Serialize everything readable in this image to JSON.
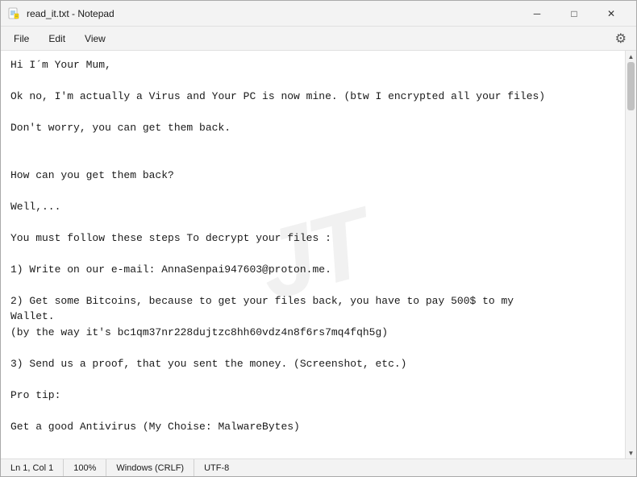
{
  "window": {
    "title": "read_it.txt - Notepad",
    "icon": "notepad-icon"
  },
  "title_controls": {
    "minimize": "─",
    "maximize": "□",
    "close": "✕"
  },
  "menu": {
    "items": [
      "File",
      "Edit",
      "View"
    ],
    "settings_icon": "⚙"
  },
  "content": {
    "text": "Hi I´m Your Mum,\n\nOk no, I'm actually a Virus and Your PC is now mine. (btw I encrypted all your files)\n\nDon't worry, you can get them back.\n\n\nHow can you get them back?\n\nWell,...\n\nYou must follow these steps To decrypt your files :\n\n1) Write on our e-mail: AnnaSenpai947603@proton.me.\n\n2) Get some Bitcoins, because to get your files back, you have to pay 500$ to my\nWallet.\n(by the way it's bc1qm37nr228dujtzc8hh60vdz4n8f6rs7mq4fqh5g)\n\n3) Send us a proof, that you sent the money. (Screenshot, etc.)\n\nPro tip:\n\nGet a good Antivirus (My Choise: MalwareBytes)"
  },
  "watermark": "JT",
  "status_bar": {
    "position": "Ln 1, Col 1",
    "zoom": "100%",
    "line_ending": "Windows (CRLF)",
    "encoding": "UTF-8"
  }
}
